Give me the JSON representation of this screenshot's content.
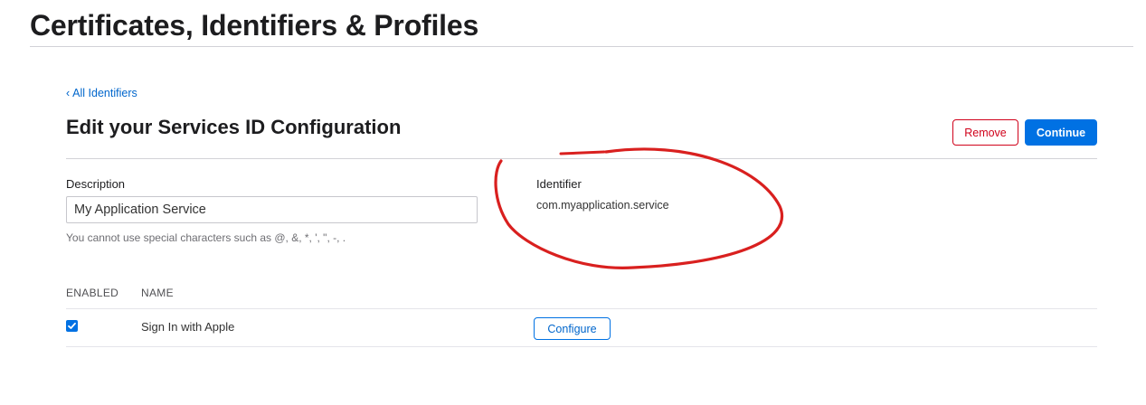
{
  "header": {
    "title": "Certificates, Identifiers & Profiles"
  },
  "nav": {
    "back_link": "All Identifiers"
  },
  "section": {
    "title": "Edit your Services ID Configuration",
    "remove_label": "Remove",
    "continue_label": "Continue"
  },
  "description": {
    "label": "Description",
    "value": "My Application Service",
    "hint": "You cannot use special characters such as @, &, *, ', \", -, ."
  },
  "identifier": {
    "label": "Identifier",
    "value": "com.myapplication.service"
  },
  "capabilities": {
    "headers": [
      "ENABLED",
      "NAME"
    ],
    "rows": [
      {
        "enabled": true,
        "name": "Sign In with Apple",
        "action_label": "Configure"
      }
    ]
  },
  "colors": {
    "accent": "#0071e3",
    "danger": "#d0021b",
    "annotation": "#d9201f"
  }
}
